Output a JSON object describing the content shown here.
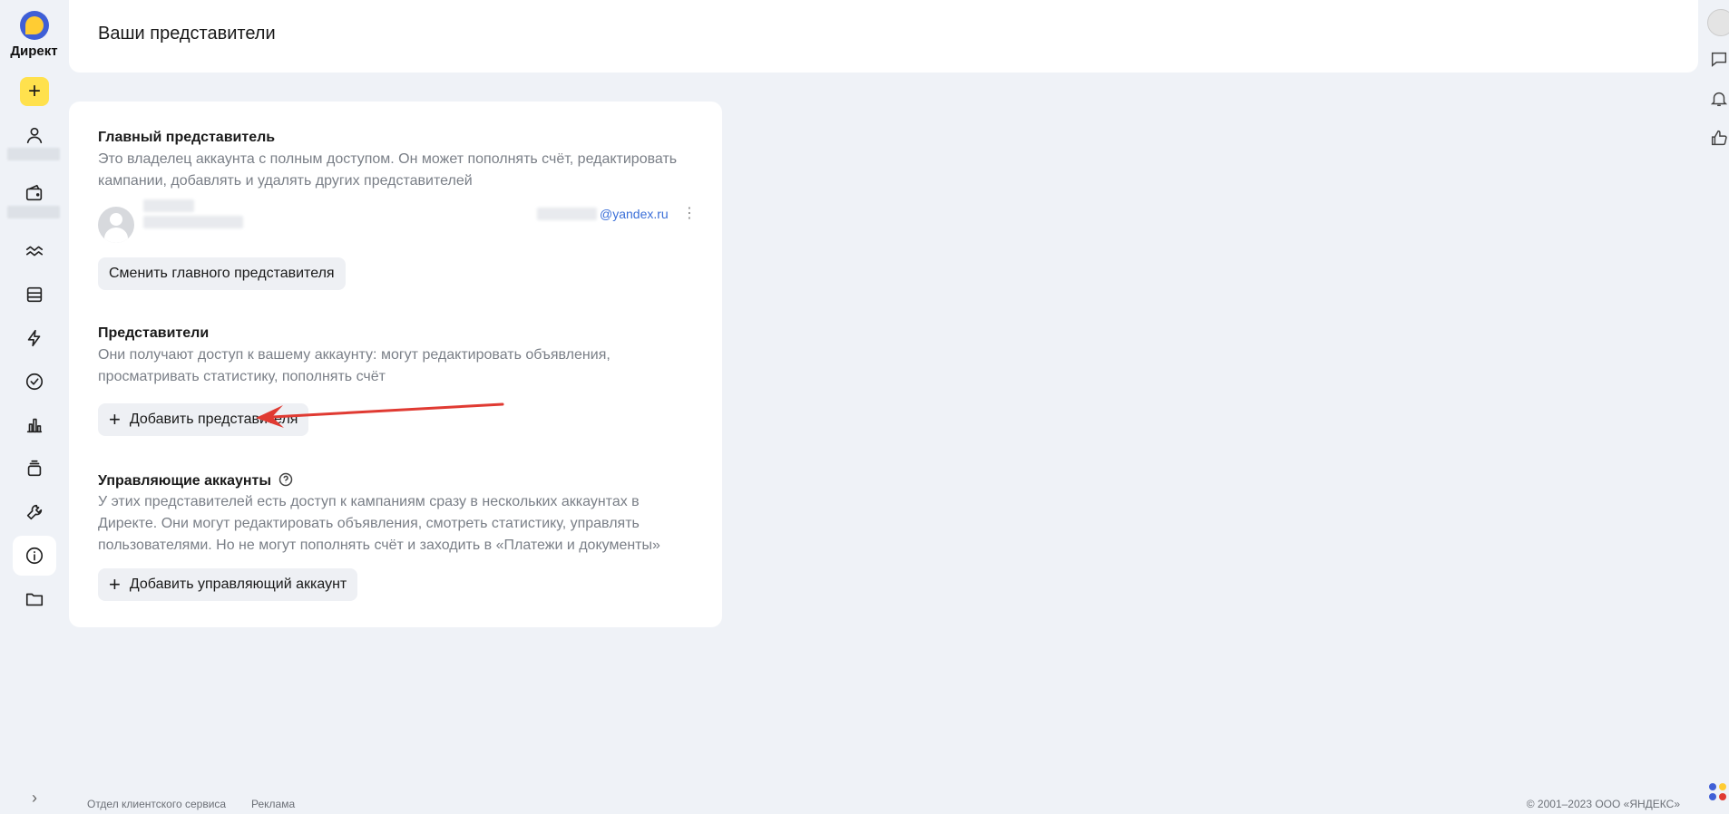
{
  "app": {
    "logo_text": "Директ"
  },
  "header": {
    "title": "Ваши представители"
  },
  "main_rep": {
    "title": "Главный представитель",
    "description": "Это владелец аккаунта с полным доступом. Он может пополнять счёт, редактировать кампании, добавлять и удалять других представителей",
    "email_domain": "@yandex.ru",
    "change_button": "Сменить главного представителя"
  },
  "reps": {
    "title": "Представители",
    "description": "Они получают доступ к вашему аккаунту: могут редактировать объявления, просматривать статистику, пополнять счёт",
    "add_button": "Добавить представителя"
  },
  "managing": {
    "title": "Управляющие аккаунты",
    "description": "У этих представителей есть доступ к кампаниям сразу в нескольких аккаунтах в Директе. Они могут редактировать объявления, смотреть статистику, управлять пользователями. Но не могут пополнять счёт и заходить в «Платежи и документы»",
    "add_button": "Добавить управляющий аккаунт"
  },
  "footer": {
    "link_service": "Отдел клиентского сервиса",
    "link_ads": "Реклама",
    "copyright": "© 2001–2023 ООО «ЯНДЕКС»"
  },
  "colors": {
    "accent_yellow": "#ffe14d",
    "link_blue": "#3b6fd8",
    "annotation_red": "#e03a32",
    "background": "#eff2f7"
  },
  "icons": {
    "rail": [
      "plus-icon",
      "user-icon",
      "wallet-icon",
      "waves-icon",
      "layers-icon",
      "lightning-icon",
      "check-circle-icon",
      "bar-chart-icon",
      "stack-icon",
      "wrench-icon",
      "info-icon",
      "folder-icon",
      "chevron-right-icon"
    ],
    "right_rail": [
      "avatar",
      "chat-icon",
      "bell-icon",
      "thumbs-up-icon"
    ]
  }
}
